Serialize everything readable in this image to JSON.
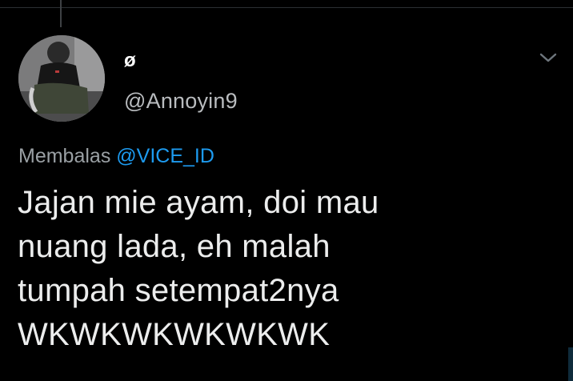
{
  "tweet": {
    "display_name": "ø",
    "handle": "@Annoyin9",
    "reply_prefix": "Membalas",
    "reply_to": "@VICE_ID",
    "text": "Jajan mie ayam, doi mau\nnuang lada, eh malah\ntumpah setempat2nya\nWKWKWKWKWKWK"
  },
  "icons": {
    "menu": "chevron-down-icon",
    "avatar": "profile-photo"
  },
  "colors": {
    "background": "#000000",
    "link": "#1d9bf0",
    "secondary_text": "#9aa0a4",
    "primary_text": "#eceded"
  }
}
